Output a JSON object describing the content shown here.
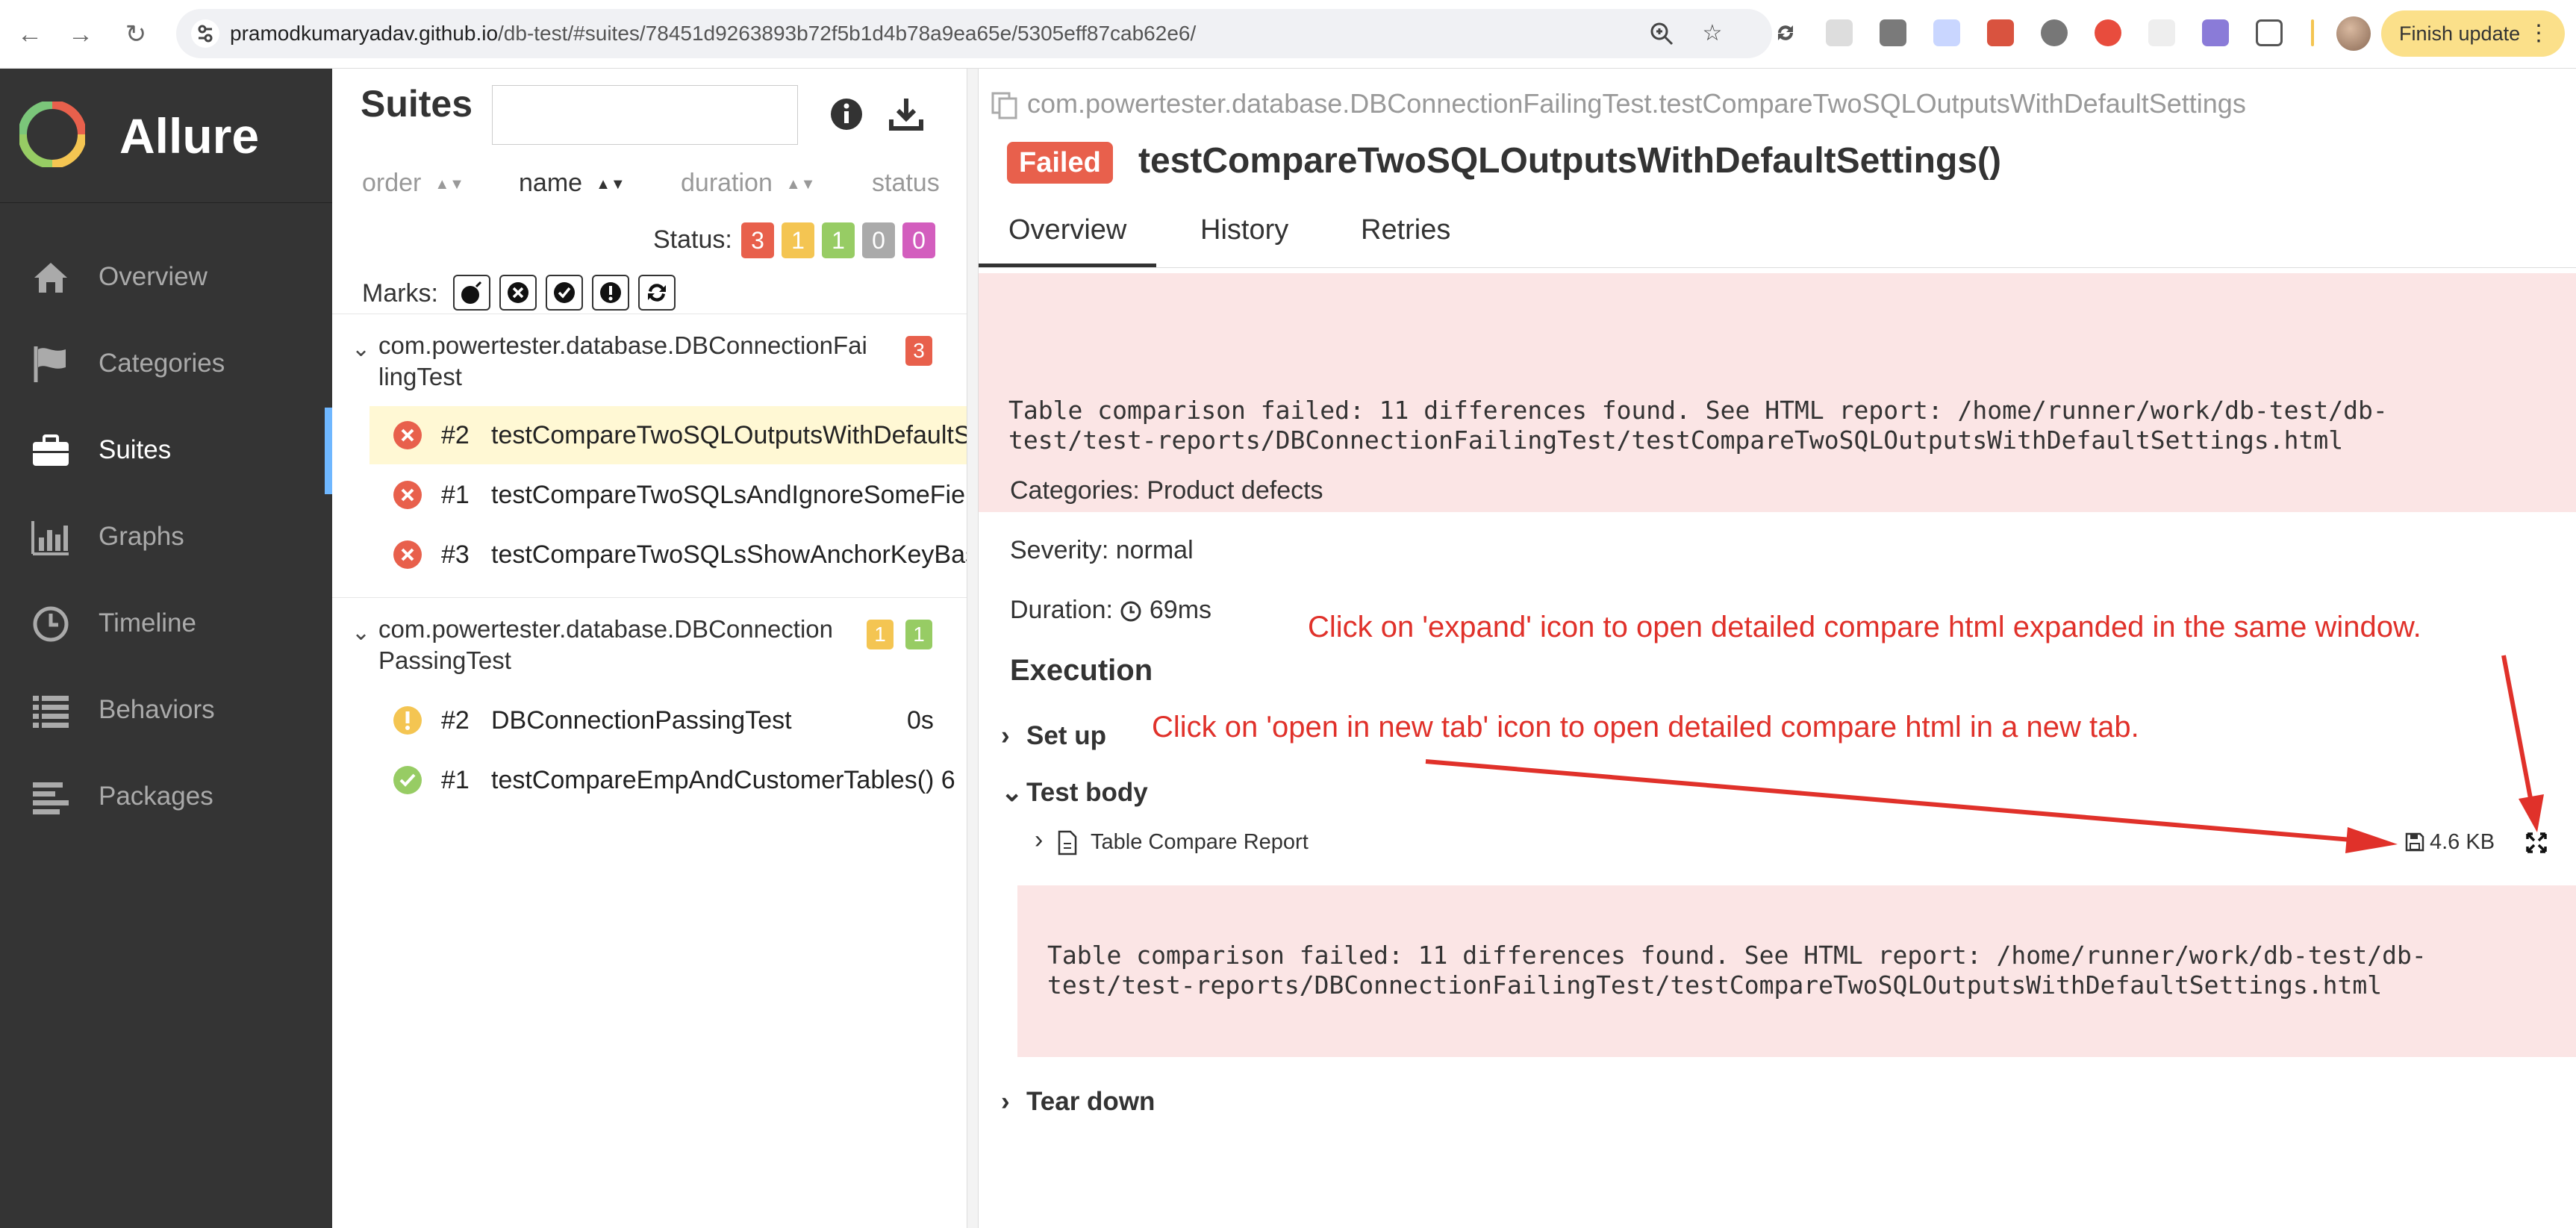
{
  "browser": {
    "url_host": "pramodkumaryadav.github.io",
    "url_path": "/db-test/#suites/78451d9263893b72f5b1d4b78a9ea65e/5305eff87cab62e6/",
    "finish_update_label": "Finish update",
    "icons": [
      "back-icon",
      "forward-icon",
      "reload-icon",
      "site-info-icon",
      "zoom-icon",
      "bookmark-star-icon",
      "extensions-icon",
      "menu-dots-icon"
    ]
  },
  "sidebar": {
    "brand": "Allure",
    "items": [
      {
        "label": "Overview",
        "icon": "home-icon"
      },
      {
        "label": "Categories",
        "icon": "flag-icon"
      },
      {
        "label": "Suites",
        "icon": "briefcase-icon",
        "active": true
      },
      {
        "label": "Graphs",
        "icon": "bar-chart-icon"
      },
      {
        "label": "Timeline",
        "icon": "clock-icon"
      },
      {
        "label": "Behaviors",
        "icon": "list-icon"
      },
      {
        "label": "Packages",
        "icon": "align-left-icon"
      }
    ]
  },
  "suites": {
    "title": "Suites",
    "search_value": "",
    "sort_columns": [
      "order",
      "name",
      "duration",
      "status"
    ],
    "status_label": "Status:",
    "status_counts": [
      {
        "value": "3",
        "color": "#e8604c"
      },
      {
        "value": "1",
        "color": "#f4c552"
      },
      {
        "value": "1",
        "color": "#97cc64"
      },
      {
        "value": "0",
        "color": "#aaaaaa"
      },
      {
        "value": "0",
        "color": "#d35ebe"
      }
    ],
    "marks_label": "Marks:",
    "groups": [
      {
        "name_line1": "com.powertester.database.DBConnectionFai",
        "name_line2": "lingTest",
        "badges": [
          {
            "value": "3",
            "color": "#e8604c"
          }
        ],
        "tests": [
          {
            "num": "#2",
            "name": "testCompareTwoSQLOutputsWithDefaultSettings()",
            "status": "failed",
            "selected": true,
            "duration": ""
          },
          {
            "num": "#1",
            "name": "testCompareTwoSQLsAndIgnoreSomeFields()",
            "status": "failed",
            "duration": ""
          },
          {
            "num": "#3",
            "name": "testCompareTwoSQLsShowAnchorKeyBased()",
            "status": "failed",
            "duration": ""
          }
        ]
      },
      {
        "name_line1": "com.powertester.database.DBConnection",
        "name_line2": "PassingTest",
        "badges": [
          {
            "value": "1",
            "color": "#f4c552"
          },
          {
            "value": "1",
            "color": "#97cc64"
          }
        ],
        "tests": [
          {
            "num": "#2",
            "name": "DBConnectionPassingTest",
            "status": "broken",
            "duration": "0s"
          },
          {
            "num": "#1",
            "name": "testCompareEmpAndCustomerTables() 6",
            "status": "passed",
            "duration": ""
          }
        ]
      }
    ]
  },
  "detail": {
    "breadcrumb": "com.powertester.database.DBConnectionFailingTest.testCompareTwoSQLOutputsWithDefaultSettings",
    "status_badge": "Failed",
    "title": "testCompareTwoSQLOutputsWithDefaultSettings()",
    "tabs": [
      "Overview",
      "History",
      "Retries"
    ],
    "error_line1": "Table comparison failed: 11 differences found. See HTML report: /home/runner/work/db-test/db-",
    "error_line2": "test/test-reports/DBConnectionFailingTest/testCompareTwoSQLOutputsWithDefaultSettings.html",
    "categories": "Categories: Product defects",
    "severity": "Severity: normal",
    "duration_label": "Duration:",
    "duration_value": "69ms",
    "execution_title": "Execution",
    "stages": {
      "setup": "Set up",
      "body": "Test body",
      "teardown": "Tear down"
    },
    "attachment": {
      "name": "Table Compare Report",
      "size": "4.6 KB"
    },
    "body_error_line1": "Table comparison failed: 11 differences found. See HTML report: /home/runner/work/db-test/db-",
    "body_error_line2": "test/test-reports/DBConnectionFailingTest/testCompareTwoSQLOutputsWithDefaultSettings.html"
  },
  "annotations": {
    "expand_note": "Click on 'expand' icon to open detailed compare html expanded in the same window.",
    "new_tab_note": "Click on 'open in new tab' icon to open detailed compare html in a new tab.",
    "color": "#e0312a"
  }
}
